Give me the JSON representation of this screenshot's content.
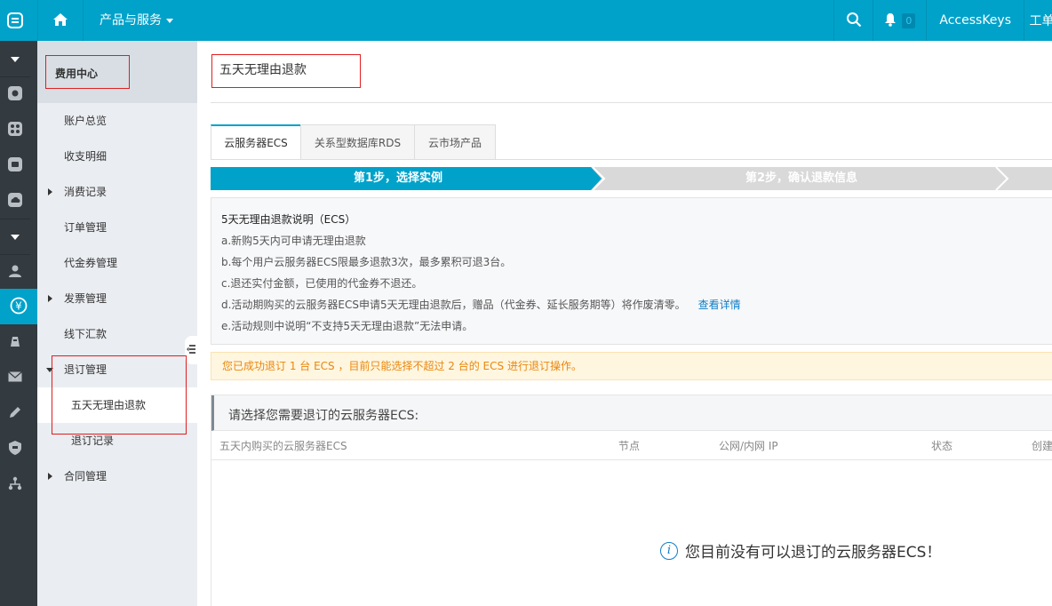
{
  "topbar": {
    "logo_icon": "aliyun-logo-icon",
    "home_icon": "home-icon",
    "products_label": "产品与服务",
    "search_icon": "search-icon",
    "bell_icon": "bell-icon",
    "notification_count": "0",
    "accesskeys_label": "AccessKeys",
    "workorder_label": "工单"
  },
  "rail": {
    "icons": [
      "caret-down-icon",
      "ecs-icon",
      "network-icon",
      "security-icon",
      "cloud-icon",
      "caret-down-icon",
      "user-icon",
      "yen-icon",
      "hat-icon",
      "mail-icon",
      "pencil-icon",
      "shield-icon",
      "hierarchy-icon"
    ]
  },
  "sidebar": {
    "title": "费用中心",
    "items": [
      {
        "label": "账户总览"
      },
      {
        "label": "收支明细"
      },
      {
        "label": "消费记录"
      },
      {
        "label": "订单管理"
      },
      {
        "label": "代金券管理"
      },
      {
        "label": "发票管理"
      },
      {
        "label": "线下汇款"
      },
      {
        "label": "退订管理"
      },
      {
        "label": "五天无理由退款"
      },
      {
        "label": "退订记录"
      },
      {
        "label": "合同管理"
      }
    ]
  },
  "main": {
    "title": "五天无理由退款",
    "tabs": [
      {
        "label": "云服务器ECS"
      },
      {
        "label": "关系型数据库RDS"
      },
      {
        "label": "云市场产品"
      }
    ],
    "steps": [
      {
        "label": "第1步，选择实例"
      },
      {
        "label": "第2步，确认退款信息"
      }
    ],
    "notice": {
      "heading": "5天无理由退款说明（ECS）",
      "lines": [
        "a.新购5天内可申请无理由退款",
        "b.每个用户云服务器ECS限最多退款3次，最多累积可退3台。",
        "c.退还实付金额，已使用的代金券不退还。",
        "d.活动期购买的云服务器ECS申请5天无理由退款后，赠品（代金券、延长服务期等）将作废清零。",
        "e.活动规则中说明“不支持5天无理由退款”无法申请。"
      ],
      "detail_link": "查看详情"
    },
    "warning": "您已成功退订 1 台 ECS ，目前只能选择不超过 2 台的 ECS 进行退订操作。",
    "panel": {
      "title": "请选择您需要退订的云服务器ECS:",
      "columns": [
        "五天内购买的云服务器ECS",
        "节点",
        "公网/内网 IP",
        "状态",
        "创建"
      ],
      "empty_message": "您目前没有可以退订的云服务器ECS！"
    }
  },
  "colors": {
    "accent": "#00a2ca",
    "rail_bg": "#333a40",
    "sidebar_bg": "#eaedf1",
    "highlight": "#e01e1e",
    "warning_text": "#e8870e",
    "link": "#0e7ec8"
  }
}
